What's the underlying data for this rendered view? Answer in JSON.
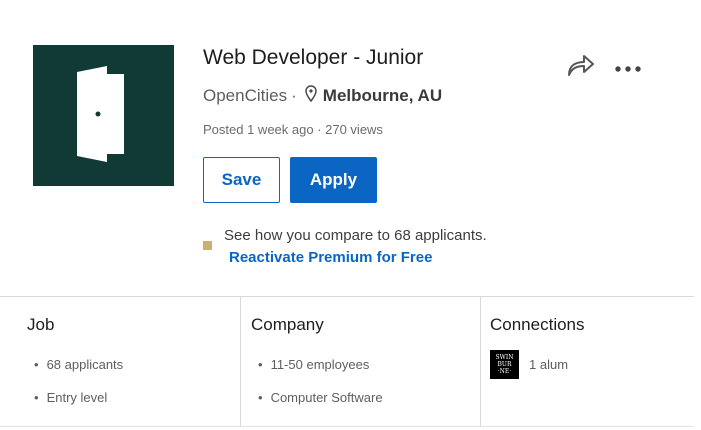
{
  "job": {
    "title": "Web Developer - Junior",
    "company": "OpenCities",
    "separator": "·",
    "location": "Melbourne, AU",
    "meta": "Posted 1 week ago · 270 views",
    "logo_bg": "#113a37"
  },
  "actions": {
    "save_label": "Save",
    "apply_label": "Apply",
    "share_icon": "share-arrow-icon",
    "more_icon": "more-dots-icon"
  },
  "premium": {
    "compare_text": "See how you compare to 68 applicants.",
    "reactivate_label": "Reactivate Premium for Free",
    "accent": "#0a66c2"
  },
  "columns": {
    "job": {
      "title": "Job",
      "items": [
        "68 applicants",
        "Entry level"
      ]
    },
    "company": {
      "title": "Company",
      "items": [
        "11-50 employees",
        "Computer Software"
      ]
    },
    "connections": {
      "title": "Connections",
      "school_logo_text": [
        "SWIN",
        "BUR",
        "·NE·"
      ],
      "alum_text": "1 alum"
    }
  }
}
